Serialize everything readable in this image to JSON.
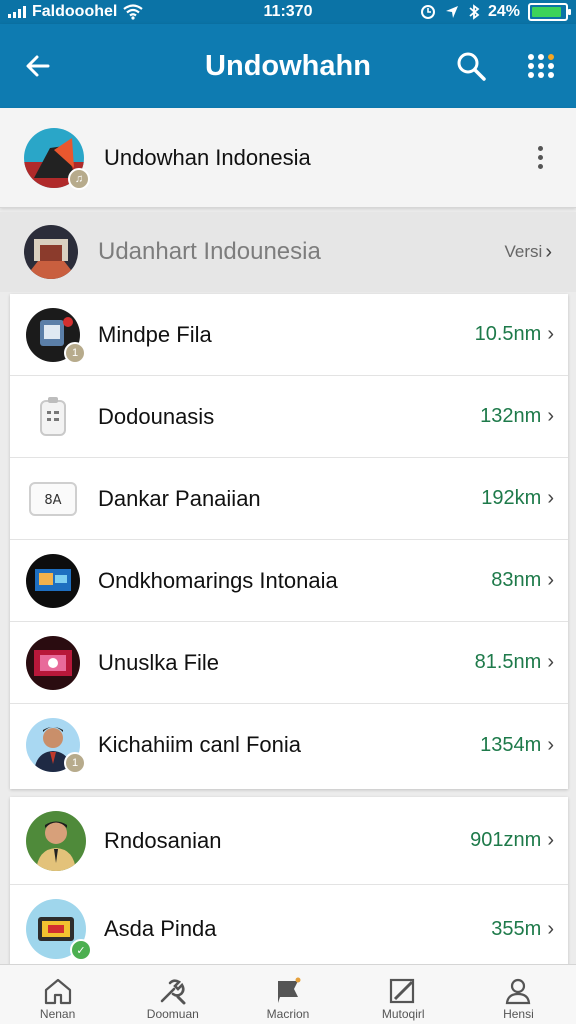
{
  "status_bar": {
    "carrier": "Faldooohel",
    "time": "11:370",
    "battery": "24%",
    "battery_level": 0.9,
    "icons": [
      "signal-icon",
      "wifi-icon",
      "alarm-icon",
      "location-icon",
      "bluetooth-icon",
      "battery-icon"
    ]
  },
  "app_bar": {
    "title": "Undowhahn",
    "icons": [
      "back-arrow-icon",
      "search-icon",
      "more-dots-icon"
    ]
  },
  "header": {
    "name": "Undowhan Indonesia",
    "icon": "more-vert-icon"
  },
  "subheader": {
    "name": "Udanhart Indounesia",
    "link": "Versi",
    "icon": "chevron-right-icon"
  },
  "list": {
    "items": [
      {
        "label": "Mindpe Fila",
        "value": "10.5nm",
        "icon": "file-avatar"
      },
      {
        "label": "Dodounasis",
        "value": "132nm",
        "icon": "device-icon"
      },
      {
        "label": "Dankar Panaiian",
        "value": "192km",
        "icon": "keyboard-icon"
      },
      {
        "label": "Ondkhomarings Intonaia",
        "value": "83nm",
        "icon": "screen-avatar"
      },
      {
        "label": "Unuslka File",
        "value": "81.5nm",
        "icon": "video-avatar"
      },
      {
        "label": "Kichahiim canl Fonia",
        "value": "1354m",
        "icon": "person-avatar"
      }
    ]
  },
  "list2": {
    "items": [
      {
        "label": "Rndosanian",
        "value": "901znm",
        "icon": "person-avatar"
      },
      {
        "label": "Asda Pinda",
        "value": "355m",
        "icon": "app-avatar"
      }
    ]
  },
  "bottom_nav": {
    "items": [
      {
        "label": "Nenan",
        "icon": "home-icon"
      },
      {
        "label": "Doomuan",
        "icon": "tools-icon"
      },
      {
        "label": "Macrion",
        "icon": "flag-icon"
      },
      {
        "label": "Mutoqirl",
        "icon": "edit-icon"
      },
      {
        "label": "Hensi",
        "icon": "profile-icon"
      }
    ]
  },
  "colors": {
    "app_bar": "#0e7bb1",
    "value_text": "#1e7a4a",
    "battery": "#3cd35a"
  }
}
